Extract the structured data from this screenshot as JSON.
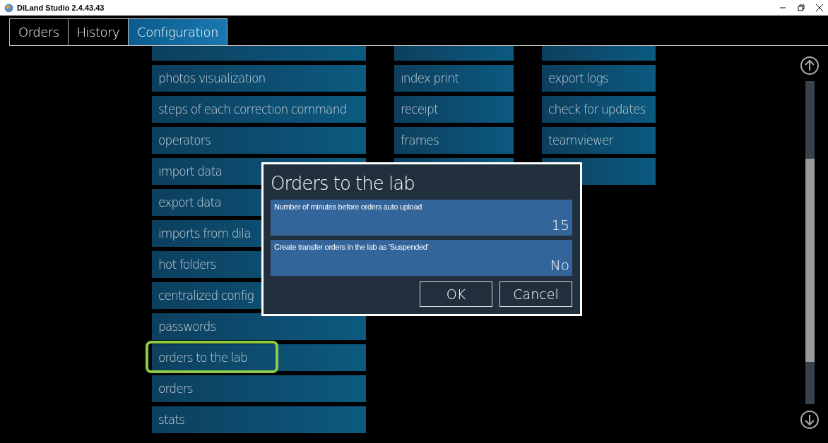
{
  "window": {
    "title": "DiLand Studio 2.4.43.43"
  },
  "tabs": [
    {
      "label": "Orders",
      "selected": false
    },
    {
      "label": "History",
      "selected": false
    },
    {
      "label": "Configuration",
      "selected": true
    }
  ],
  "columns": [
    {
      "items": [
        {
          "highlighted": false
        },
        {
          "label": "photos visualization",
          "highlighted": false
        },
        {
          "label": "steps of each correction command",
          "highlighted": false
        },
        {
          "label": "operators",
          "highlighted": false
        },
        {
          "label": "import data",
          "highlighted": false
        },
        {
          "label": "export data",
          "highlighted": false
        },
        {
          "label": "imports from dila",
          "highlighted": false
        },
        {
          "label": "hot folders",
          "highlighted": false
        },
        {
          "label": "centralized config",
          "highlighted": false
        },
        {
          "label": "passwords",
          "highlighted": false
        },
        {
          "label": "orders to the lab",
          "highlighted": true
        },
        {
          "label": "orders",
          "highlighted": false
        },
        {
          "label": "stats",
          "highlighted": false
        }
      ]
    },
    {
      "items": [
        {
          "highlighted": false
        },
        {
          "label": "index print",
          "highlighted": false
        },
        {
          "label": "receipt",
          "highlighted": false
        },
        {
          "label": "frames",
          "highlighted": false
        },
        {
          "highlighted": false
        }
      ]
    },
    {
      "items": [
        {
          "highlighted": false
        },
        {
          "label": "export logs",
          "highlighted": false
        },
        {
          "label": "check for updates",
          "highlighted": false
        },
        {
          "label": "teamviewer",
          "highlighted": false
        },
        {
          "highlighted": false
        }
      ]
    }
  ],
  "dialog": {
    "title": "Orders to the lab",
    "fields": [
      {
        "label": "Number of minutes before orders auto upload",
        "value": "15"
      },
      {
        "label": "Create transfer orders in the lab as 'Suspended'",
        "value": "No"
      }
    ],
    "buttons": [
      "OK",
      "Cancel"
    ]
  }
}
